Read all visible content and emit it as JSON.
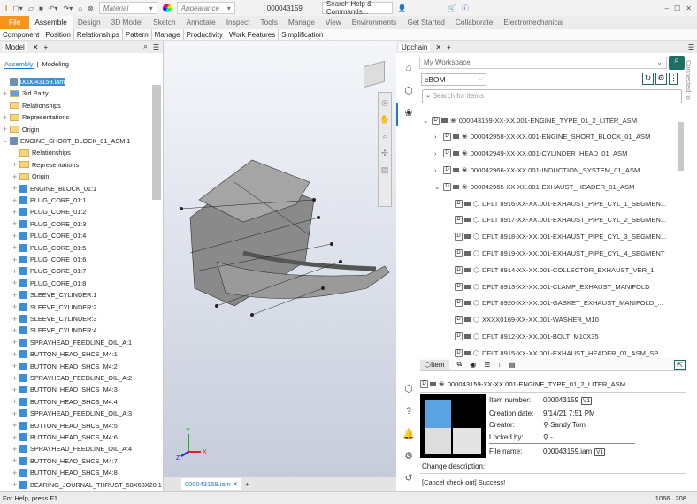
{
  "qat": {
    "material": "Material",
    "appearance": "Appearance",
    "doc_number": "000043159",
    "search_placeholder": "Search Help & Commands..."
  },
  "ribbon_tabs": [
    "File",
    "Assemble",
    "Design",
    "3D Model",
    "Sketch",
    "Annotate",
    "Inspect",
    "Tools",
    "Manage",
    "View",
    "Environments",
    "Get Started",
    "Collaborate",
    "Electromechanical"
  ],
  "panels": [
    "Component",
    "Position",
    "Relationships",
    "Pattern",
    "Manage",
    "Productivity",
    "Work Features",
    "Simplification"
  ],
  "model": {
    "tab": "Model",
    "subtabs": [
      "Assembly",
      "Modeling"
    ],
    "tree": [
      {
        "label": "000043159.iam",
        "indent": 0,
        "type": "asm",
        "pm": ""
      },
      {
        "label": "3rd Party",
        "indent": 0,
        "type": "party",
        "pm": "+"
      },
      {
        "label": "Relationships",
        "indent": 0,
        "type": "folder",
        "pm": ""
      },
      {
        "label": "Representations",
        "indent": 0,
        "type": "folder",
        "pm": "+"
      },
      {
        "label": "Origin",
        "indent": 0,
        "type": "folder",
        "pm": "+"
      },
      {
        "label": "ENGINE_SHORT_BLOCK_01_ASM:1",
        "indent": 0,
        "type": "asm",
        "pm": "−"
      },
      {
        "label": "Relationships",
        "indent": 1,
        "type": "folder",
        "pm": ""
      },
      {
        "label": "Representations",
        "indent": 1,
        "type": "folder",
        "pm": "+"
      },
      {
        "label": "Origin",
        "indent": 1,
        "type": "folder",
        "pm": "+"
      },
      {
        "label": "ENGINE_BLOCK_01:1",
        "indent": 1,
        "type": "part",
        "pm": "+"
      },
      {
        "label": "PLUG_CORE_01:1",
        "indent": 1,
        "type": "part",
        "pm": "+"
      },
      {
        "label": "PLUG_CORE_01:2",
        "indent": 1,
        "type": "part",
        "pm": "+"
      },
      {
        "label": "PLUG_CORE_01:3",
        "indent": 1,
        "type": "part",
        "pm": "+"
      },
      {
        "label": "PLUG_CORE_01:4",
        "indent": 1,
        "type": "part",
        "pm": "+"
      },
      {
        "label": "PLUG_CORE_01:5",
        "indent": 1,
        "type": "part",
        "pm": "+"
      },
      {
        "label": "PLUG_CORE_01:6",
        "indent": 1,
        "type": "part",
        "pm": "+"
      },
      {
        "label": "PLUG_CORE_01:7",
        "indent": 1,
        "type": "part",
        "pm": "+"
      },
      {
        "label": "PLUG_CORE_01:8",
        "indent": 1,
        "type": "part",
        "pm": "+"
      },
      {
        "label": "SLEEVE_CYLINDER:1",
        "indent": 1,
        "type": "part",
        "pm": "+"
      },
      {
        "label": "SLEEVE_CYLINDER:2",
        "indent": 1,
        "type": "part",
        "pm": "+"
      },
      {
        "label": "SLEEVE_CYLINDER:3",
        "indent": 1,
        "type": "part",
        "pm": "+"
      },
      {
        "label": "SLEEVE_CYLINDER:4",
        "indent": 1,
        "type": "part",
        "pm": "+"
      },
      {
        "label": "SPRAYHEAD_FEEDLINE_OIL_A:1",
        "indent": 1,
        "type": "part",
        "pm": "+"
      },
      {
        "label": "BUTTON_HEAD_SHCS_M4:1",
        "indent": 1,
        "type": "part",
        "pm": "+"
      },
      {
        "label": "BUTTON_HEAD_SHCS_M4:2",
        "indent": 1,
        "type": "part",
        "pm": "+"
      },
      {
        "label": "SPRAYHEAD_FEEDLINE_OIL_A:2",
        "indent": 1,
        "type": "part",
        "pm": "+"
      },
      {
        "label": "BUTTON_HEAD_SHCS_M4:3",
        "indent": 1,
        "type": "part",
        "pm": "+"
      },
      {
        "label": "BUTTON_HEAD_SHCS_M4:4",
        "indent": 1,
        "type": "part",
        "pm": "+"
      },
      {
        "label": "SPRAYHEAD_FEEDLINE_OIL_A:3",
        "indent": 1,
        "type": "part",
        "pm": "+"
      },
      {
        "label": "BUTTON_HEAD_SHCS_M4:5",
        "indent": 1,
        "type": "part",
        "pm": "+"
      },
      {
        "label": "BUTTON_HEAD_SHCS_M4:6",
        "indent": 1,
        "type": "part",
        "pm": "+"
      },
      {
        "label": "SPRAYHEAD_FEEDLINE_OIL_A:4",
        "indent": 1,
        "type": "part",
        "pm": "+"
      },
      {
        "label": "BUTTON_HEAD_SHCS_M4:7",
        "indent": 1,
        "type": "part",
        "pm": "+"
      },
      {
        "label": "BUTTON_HEAD_SHCS_M4:8",
        "indent": 1,
        "type": "part",
        "pm": "+"
      },
      {
        "label": "BEARING_JOURNAL_THRUST_58X63X20:1",
        "indent": 1,
        "type": "part",
        "pm": "+"
      }
    ]
  },
  "viewport": {
    "doc_tab": "000043159.iam",
    "axes": {
      "x": "X",
      "y": "Y",
      "z": "Z"
    }
  },
  "upchain": {
    "tab": "Upchain",
    "workspace": "My Workspace",
    "bom": "cBOM",
    "search_placeholder": "Search for items",
    "connected": "Connected to",
    "items": [
      {
        "label": "000043159-XX-XX.001-ENGINE_TYPE_01_2_LITER_ASM",
        "level": 0,
        "toggle": "⌄",
        "kind": "asm"
      },
      {
        "label": "000042958-XX-XX.001-ENGINE_SHORT_BLOCK_01_ASM",
        "level": 1,
        "toggle": "›",
        "kind": "asm"
      },
      {
        "label": "000042949-XX-XX.001-CYLINDER_HEAD_01_ASM",
        "level": 1,
        "toggle": "›",
        "kind": "asm"
      },
      {
        "label": "000042966-XX-XX.001-INDUCTION_SYSTEM_01_ASM",
        "level": 1,
        "toggle": "›",
        "kind": "asm"
      },
      {
        "label": "000042965-XX-XX.001-EXHAUST_HEADER_01_ASM",
        "level": 1,
        "toggle": "⌄",
        "kind": "asm"
      },
      {
        "label": "DFLT 8916-XX-XX.001-EXHAUST_PIPE_CYL_1_SEGMEN...",
        "level": 2,
        "toggle": "",
        "kind": "part"
      },
      {
        "label": "DFLT 8917-XX-XX.001-EXHAUST_PIPE_CYL_2_SEGMEN...",
        "level": 2,
        "toggle": "",
        "kind": "part"
      },
      {
        "label": "DFLT 8918-XX-XX.001-EXHAUST_PIPE_CYL_3_SEGMEN...",
        "level": 2,
        "toggle": "",
        "kind": "part"
      },
      {
        "label": "DFLT 8919-XX-XX.001-EXHAUST_PIPE_CYL_4_SEGMENT",
        "level": 2,
        "toggle": "",
        "kind": "part"
      },
      {
        "label": "DFLT 8914-XX-XX.001-COLLECTOR_EXHAUST_VER_1",
        "level": 2,
        "toggle": "",
        "kind": "part"
      },
      {
        "label": "DFLT 8913-XX-XX.001-CLAMP_EXHAUST_MANIFOLD",
        "level": 2,
        "toggle": "",
        "kind": "part"
      },
      {
        "label": "DFLT 8920-XX-XX.001-GASKET_EXHAUST_MANIFOLD_...",
        "level": 2,
        "toggle": "",
        "kind": "part"
      },
      {
        "label": "XXXX0169-XX-XX.001-WASHER_M10",
        "level": 2,
        "toggle": "",
        "kind": "part"
      },
      {
        "label": "DFLT 8912-XX-XX.001-BOLT_M10X35",
        "level": 2,
        "toggle": "",
        "kind": "part"
      },
      {
        "label": "DFLT 8915-XX-XX.001-EXHAUST_HEADER_01_ASM_SP...",
        "level": 2,
        "toggle": "",
        "kind": "part"
      }
    ],
    "detail": {
      "tab": "Item",
      "title": "000043159-XX-XX.001-ENGINE_TYPE_01_2_LITER_ASM",
      "item_number_label": "Item number:",
      "item_number": "000043159",
      "version": "V1",
      "creation_label": "Creation date:",
      "creation": "9/14/21 7:51 PM",
      "creator_label": "Creator:",
      "creator": "Sandy Tom",
      "locked_label": "Locked by:",
      "locked": "-",
      "file_label": "File name:",
      "file": "000043159.iam",
      "file_version": "V1",
      "change_label": "Change description:"
    },
    "message": "[Cancel check out] Success!"
  },
  "status": {
    "help": "For Help, press F1",
    "x": "1066",
    "y": "208"
  },
  "colors": {
    "file_tab": "#f7941d",
    "accent": "#1e6f63",
    "selection": "#3a8fd9"
  }
}
